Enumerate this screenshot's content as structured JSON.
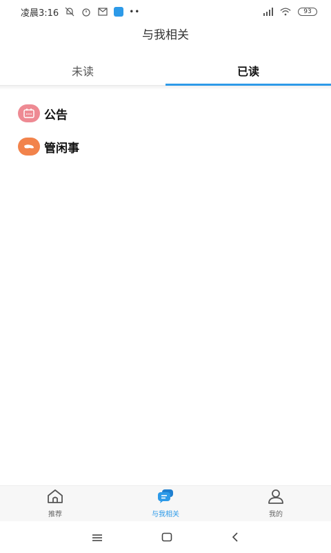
{
  "status_bar": {
    "time": "凌晨3:16",
    "battery": "93",
    "icons": [
      "bell-off-icon",
      "alarm-icon",
      "mail-icon",
      "app-icon",
      "more-dots-icon",
      "hd-signal-icon",
      "wifi-icon",
      "battery-icon"
    ],
    "dots": "••"
  },
  "header": {
    "title": "与我相关"
  },
  "tabs": [
    {
      "label": "未读",
      "active": false
    },
    {
      "label": "已读",
      "active": true
    }
  ],
  "list": [
    {
      "label": "公告",
      "icon": "notice-icon",
      "color": "#ee8a93"
    },
    {
      "label": "管闲事",
      "icon": "hand-icon",
      "color": "#f2834b"
    }
  ],
  "bottom_nav": [
    {
      "label": "推荐",
      "icon": "home-icon",
      "active": false
    },
    {
      "label": "与我相关",
      "icon": "chat-bubble-icon",
      "active": true
    },
    {
      "label": "我的",
      "icon": "user-icon",
      "active": false
    }
  ],
  "colors": {
    "accent": "#2d9ae8",
    "notice": "#ee8a93",
    "hand": "#f2834b"
  }
}
